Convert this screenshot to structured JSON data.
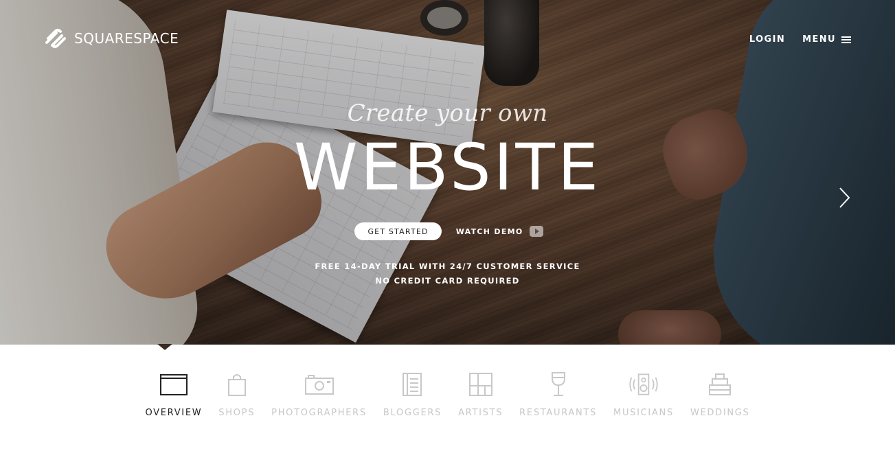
{
  "brand": {
    "name": "SQUARESPACE",
    "logo_icon": "squarespace-logo-icon"
  },
  "nav": {
    "login": "LOGIN",
    "menu": "MENU",
    "menu_icon": "hamburger-icon"
  },
  "hero": {
    "tagline": "Create your own",
    "headline": "WEBSITE",
    "get_started": "GET STARTED",
    "watch_demo": "WATCH DEMO",
    "trial_line1": "FREE 14-DAY TRIAL WITH 24/7 CUSTOMER SERVICE",
    "trial_line2": "NO CREDIT CARD REQUIRED",
    "next_icon": "chevron-right-icon"
  },
  "tabs": [
    {
      "label": "OVERVIEW",
      "icon": "browser-window-icon",
      "active": true
    },
    {
      "label": "SHOPS",
      "icon": "shopping-bag-icon",
      "active": false
    },
    {
      "label": "PHOTOGRAPHERS",
      "icon": "camera-icon",
      "active": false
    },
    {
      "label": "BLOGGERS",
      "icon": "notebook-icon",
      "active": false
    },
    {
      "label": "ARTISTS",
      "icon": "frame-grid-icon",
      "active": false
    },
    {
      "label": "RESTAURANTS",
      "icon": "wine-glass-icon",
      "active": false
    },
    {
      "label": "MUSICIANS",
      "icon": "speaker-icon",
      "active": false
    },
    {
      "label": "WEDDINGS",
      "icon": "cake-icon",
      "active": false
    }
  ],
  "colors": {
    "active_tab": "#222222",
    "inactive_tab": "#c8c8c8",
    "hero_text": "#ffffff"
  }
}
